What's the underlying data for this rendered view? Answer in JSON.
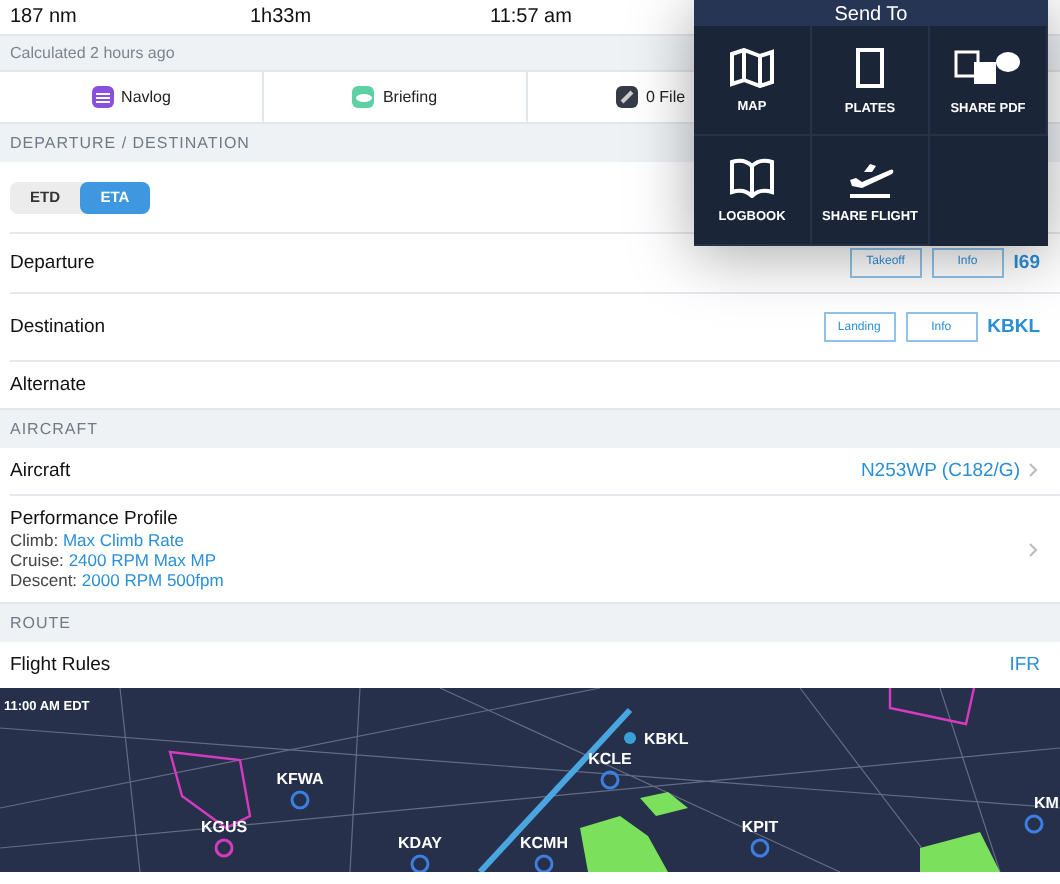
{
  "summary": [
    "187 nm",
    "1h33m",
    "11:57 am"
  ],
  "calculated": "Calculated 2 hours ago",
  "tabs": [
    {
      "label": "Navlog",
      "kind": "navlog"
    },
    {
      "label": "Briefing",
      "kind": "briefing"
    },
    {
      "label": "0 File",
      "kind": "files"
    }
  ],
  "sections": [
    {
      "title": "DEPARTURE / DESTINATION",
      "rows": [
        {
          "kind": "toggle",
          "options": [
            {
              "label": "ETD",
              "selected": false
            },
            {
              "label": "ETA",
              "selected": true
            }
          ]
        },
        {
          "kind": "airport",
          "label": "Departure",
          "buttons": [
            "Takeoff",
            "Info"
          ],
          "value": "I69"
        },
        {
          "kind": "airport",
          "label": "Destination",
          "buttons": [
            "Landing",
            "Info"
          ],
          "value": "KBKL"
        },
        {
          "kind": "plain",
          "label": "Alternate"
        }
      ]
    },
    {
      "title": "AIRCRAFT",
      "rows": [
        {
          "kind": "link",
          "label": "Aircraft",
          "value": "N253WP (C182/G)"
        },
        {
          "kind": "profile",
          "label": "Performance Profile",
          "details": [
            {
              "name": "Climb:",
              "value": "Max Climb Rate"
            },
            {
              "name": "Cruise:",
              "value": "2400 RPM Max MP"
            },
            {
              "name": "Descent:",
              "value": "2000 RPM 500fpm"
            }
          ]
        }
      ]
    },
    {
      "title": "ROUTE",
      "rows": [
        {
          "kind": "value",
          "label": "Flight Rules",
          "value": "IFR"
        }
      ]
    }
  ],
  "map": {
    "time": "11:00 AM EDT",
    "airports": [
      {
        "code": "KBKL",
        "kind": "destination"
      },
      {
        "code": "KCLE",
        "kind": "towered"
      },
      {
        "code": "KFWA",
        "kind": "towered"
      },
      {
        "code": "KM",
        "kind": "towered"
      },
      {
        "code": "KGUS",
        "kind": "military"
      },
      {
        "code": "KPIT",
        "kind": "towered"
      },
      {
        "code": "KDAY",
        "kind": "towered"
      },
      {
        "code": "KCMH",
        "kind": "towered"
      }
    ]
  },
  "send_to": {
    "title": "Send To",
    "items": [
      {
        "label": "MAP",
        "kind": "map"
      },
      {
        "label": "PLATES",
        "kind": "plates"
      },
      {
        "label": "SHARE PDF",
        "kind": "pdf"
      },
      {
        "label": "LOGBOOK",
        "kind": "logbook"
      },
      {
        "label": "SHARE FLIGHT",
        "kind": "flight"
      }
    ]
  }
}
